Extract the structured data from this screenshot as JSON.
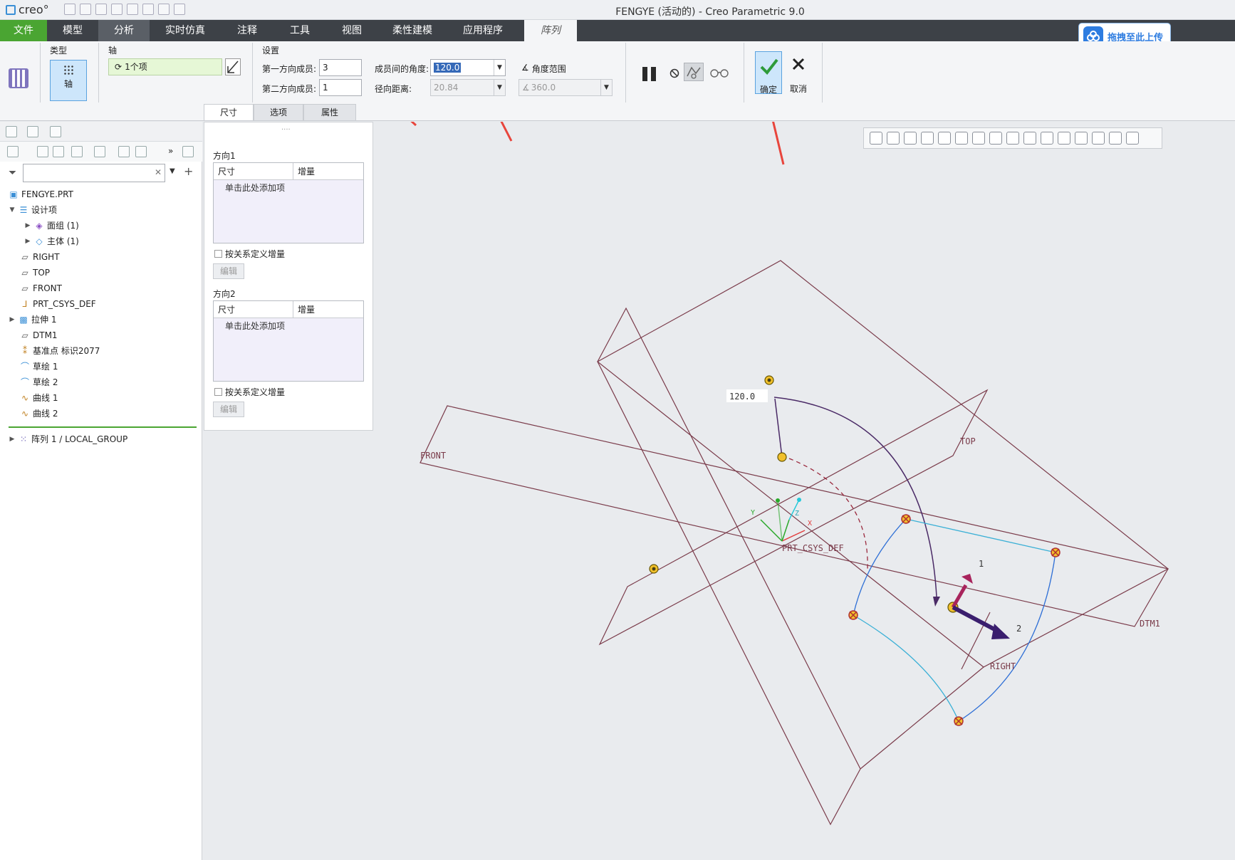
{
  "app": {
    "logo_text": "creo°",
    "window_title": "FENGYE (活动的) - Creo Parametric 9.0"
  },
  "ribbon_tabs": [
    "文件",
    "模型",
    "分析",
    "实时仿真",
    "注释",
    "工具",
    "视图",
    "柔性建模",
    "应用程序",
    "阵列"
  ],
  "upload_button": "拖拽至此上传",
  "ribbon": {
    "type_group": {
      "label": "类型",
      "axis_button": "轴"
    },
    "axis_group": {
      "label": "轴",
      "collector": "1个项"
    },
    "settings_group": {
      "label": "设置",
      "first_dir_label": "第一方向成员:",
      "first_dir_value": "3",
      "second_dir_label": "第二方向成员:",
      "second_dir_value": "1",
      "angle_between_label": "成员间的角度:",
      "angle_between_value": "120.0",
      "radial_dist_label": "径向距离:",
      "radial_dist_value": "20.84",
      "angle_range_label": "角度范围",
      "angle_range_value": "360.0"
    },
    "ok_label": "确定",
    "cancel_label": "取消"
  },
  "subtabs": [
    "尺寸",
    "选项",
    "属性"
  ],
  "dims_panel": {
    "dir1_label": "方向1",
    "dir2_label": "方向2",
    "col_dim": "尺寸",
    "col_inc": "增量",
    "add_hint": "单击此处添加项",
    "relation_check": "按关系定义增量",
    "edit_button": "编辑"
  },
  "model_tree": {
    "items": [
      {
        "label": "FENGYE.PRT",
        "icon": "part-icon"
      },
      {
        "label": "设计项",
        "icon": "design-items-icon"
      },
      {
        "label": "面组 (1)",
        "icon": "quilt-icon"
      },
      {
        "label": "主体 (1)",
        "icon": "body-icon"
      },
      {
        "label": "RIGHT",
        "icon": "plane-icon"
      },
      {
        "label": "TOP",
        "icon": "plane-icon"
      },
      {
        "label": "FRONT",
        "icon": "plane-icon"
      },
      {
        "label": "PRT_CSYS_DEF",
        "icon": "csys-icon"
      },
      {
        "label": "拉伸 1",
        "icon": "extrude-icon"
      },
      {
        "label": "DTM1",
        "icon": "plane-icon"
      },
      {
        "label": "基准点 标识2077",
        "icon": "datum-point-icon"
      },
      {
        "label": "草绘 1",
        "icon": "sketch-icon"
      },
      {
        "label": "草绘 2",
        "icon": "sketch-icon"
      },
      {
        "label": "曲线 1",
        "icon": "curve-icon"
      },
      {
        "label": "曲线 2",
        "icon": "curve-icon"
      },
      {
        "label": "阵列 1 / LOCAL_GROUP",
        "icon": "pattern-icon"
      }
    ]
  },
  "graphics": {
    "plane_front": "FRONT",
    "plane_top": "TOP",
    "plane_right": "RIGHT",
    "plane_dtm1": "DTM1",
    "csys_label": "PRT_CSYS_DEF",
    "angle_dim": "120.0",
    "dir1_marker": "1",
    "dir2_marker": "2",
    "axis_x": "X",
    "axis_y": "Y",
    "axis_z": "Z"
  },
  "colors": {
    "file_tab": "#4aa532",
    "ok_highlight": "#cde6fb",
    "datum_plane": "#7a3b4a",
    "curve": "#2e6fd6",
    "annotation_arrow": "#e8453c"
  }
}
